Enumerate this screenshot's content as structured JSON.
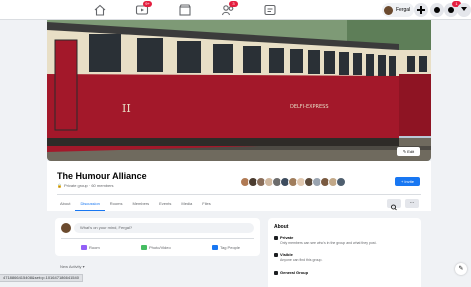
{
  "top_nav": {
    "icons": [
      {
        "name": "home-icon",
        "badge": ""
      },
      {
        "name": "watch-icon",
        "badge": "9+"
      },
      {
        "name": "marketplace-icon",
        "badge": ""
      },
      {
        "name": "groups-icon",
        "badge": "3"
      },
      {
        "name": "gaming-icon",
        "badge": ""
      }
    ],
    "profile_name": "Fergal",
    "messenger_badge": "1"
  },
  "cover": {
    "edit_label": "Edit",
    "carriage_number": "II",
    "carriage_plate": "DELFI-EXPRESS"
  },
  "group": {
    "name": "The Humour Alliance",
    "privacy_line": "Private group · 60 members",
    "invite_label": "+ Invite",
    "member_avatar_colors": [
      "#b07a54",
      "#4a3b2f",
      "#8a6e5a",
      "#d1b9a0",
      "#6c6c6c",
      "#3d4c5e",
      "#a07d5c",
      "#e0c8b0",
      "#5c4a3a",
      "#9aa4b0",
      "#7a5a40",
      "#c2a888",
      "#4f5f6f"
    ]
  },
  "tabs": [
    "About",
    "Discussion",
    "Rooms",
    "Members",
    "Events",
    "Media",
    "Files"
  ],
  "active_tab": "Discussion",
  "tab_more_label": "···",
  "composer": {
    "placeholder": "What's on your mind, Fergal?",
    "actions": [
      {
        "label": "Room",
        "color": "#9360f7"
      },
      {
        "label": "Photo/Video",
        "color": "#45bd62"
      },
      {
        "label": "Tag People",
        "color": "#1877f2"
      }
    ]
  },
  "activity_label": "New Activity ▾",
  "about": {
    "title": "About",
    "items": [
      {
        "title": "Private",
        "desc": "Only members can see who's in the group and what they post."
      },
      {
        "title": "Visible",
        "desc": "Anyone can find this group."
      },
      {
        "title": "General Group",
        "desc": ""
      }
    ]
  },
  "status_url": "4718866415408&set=p.101647186641540",
  "fab_label": "✎"
}
